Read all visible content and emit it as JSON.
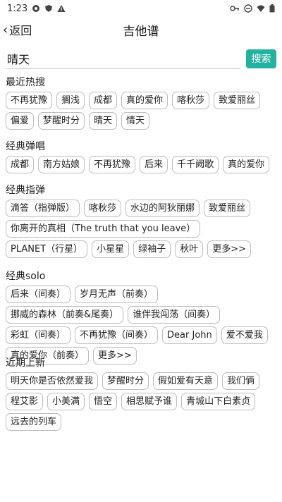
{
  "status": {
    "time": "1:23",
    "icons_left": [
      "settings-icon",
      "shield-icon",
      "warning-icon"
    ],
    "icons_right": [
      "key-icon",
      "dnd-icon",
      "wifi-icon",
      "battery-icon"
    ]
  },
  "header": {
    "back_label": "返回",
    "title": "吉他谱"
  },
  "search": {
    "value": "晴天",
    "button_label": "搜索"
  },
  "sections": [
    {
      "title": "最近热搜",
      "tags": [
        "不再犹豫",
        "搁浅",
        "成都",
        "真的爱你",
        "喀秋莎",
        "致爱丽丝",
        "偏爱",
        "梦醒时分",
        "晴天",
        "情天"
      ]
    },
    {
      "title": "经典弹唱",
      "tags": [
        "成都",
        "南方姑娘",
        "不再犹豫",
        "后来",
        "千千阙歌",
        "真的爱你"
      ]
    },
    {
      "title": "经典指弹",
      "tags": [
        "滴答（指弹版）",
        "喀秋莎",
        "水边的阿狄丽娜",
        "致爱丽丝",
        "你离开的真相（The truth that you leave）",
        "PLANET（行星）",
        "小星星",
        "绿袖子",
        "秋叶",
        "更多>>"
      ]
    },
    {
      "title": "经典solo",
      "tags": [
        "后来（间奏）",
        "岁月无声（前奏）",
        "挪威的森林（前奏&尾奏）",
        "谁伴我闯荡（间奏）",
        "彩虹（间奏）",
        "不再犹豫（间奏）",
        "Dear John",
        "爱不爱我",
        "真的爱你（前奏）",
        "更多>>"
      ]
    },
    {
      "title": "近期上新",
      "tags": [
        "明天你是否依然爱我",
        "梦醒时分",
        "假如爱有天意",
        "我们俩",
        "程艾影",
        "小美满",
        "悟空",
        "相思赋予谁",
        "青城山下白素贞",
        "远去的列车"
      ]
    }
  ],
  "colors": {
    "accent": "#22b3a0",
    "tag_border": "#bdbdbd"
  }
}
